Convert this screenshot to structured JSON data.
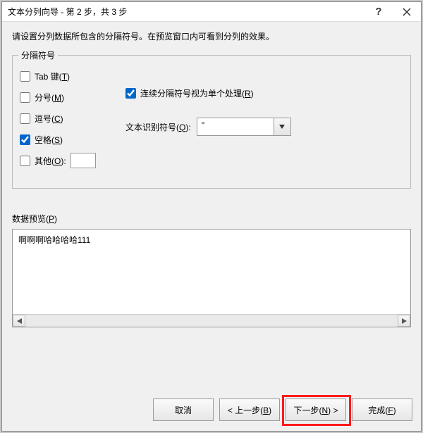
{
  "titlebar": {
    "title": "文本分列向导 - 第 2 步，共 3 步"
  },
  "instruction": "请设置分列数据所包含的分隔符号。在预览窗口内可看到分列的效果。",
  "delimiters": {
    "legend": "分隔符号",
    "tab": {
      "label_pre": "Tab 键(",
      "u": "T",
      "label_post": ")",
      "checked": false
    },
    "semicolon": {
      "label_pre": "分号(",
      "u": "M",
      "label_post": ")",
      "checked": false
    },
    "comma": {
      "label_pre": "逗号(",
      "u": "C",
      "label_post": ")",
      "checked": false
    },
    "space": {
      "label_pre": "空格(",
      "u": "S",
      "label_post": ")",
      "checked": true
    },
    "other": {
      "label_pre": "其他(",
      "u": "O",
      "label_post": "):",
      "checked": false,
      "value": ""
    }
  },
  "treat_consecutive": {
    "label_pre": "连续分隔符号视为单个处理(",
    "u": "R",
    "label_post": ")",
    "checked": true
  },
  "text_qualifier": {
    "label_pre": "文本识别符号(",
    "u": "Q",
    "label_post": "):",
    "value": "\""
  },
  "preview": {
    "label_pre": "数据预览(",
    "u": "P",
    "label_post": ")",
    "content": "啊啊啊哈哈哈哈111"
  },
  "buttons": {
    "cancel": {
      "text": "取消"
    },
    "back": {
      "pre": "< 上一步(",
      "u": "B",
      "post": ")"
    },
    "next": {
      "pre": "下一步(",
      "u": "N",
      "post": ") >"
    },
    "finish": {
      "pre": "完成(",
      "u": "F",
      "post": ")"
    }
  }
}
